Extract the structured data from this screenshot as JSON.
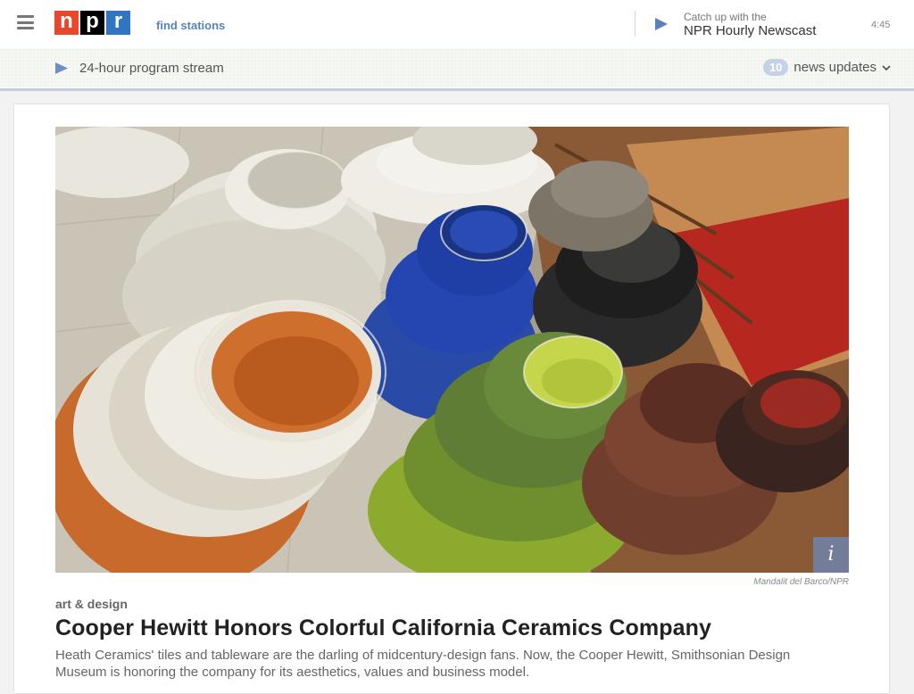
{
  "header": {
    "logo_letters": [
      "n",
      "p",
      "r"
    ],
    "find_stations": "find stations",
    "newscast": {
      "subtitle": "Catch up with the",
      "title": "NPR Hourly Newscast",
      "duration": "4:45"
    }
  },
  "stream_bar": {
    "stream_label": "24-hour program stream",
    "updates_count": "10",
    "updates_label": "news updates"
  },
  "story": {
    "image_alt": "Stacks of colorful ceramic bowls",
    "credit": "Mandalit del Barco/NPR",
    "info_label": "i",
    "slug": "art & design",
    "headline": "Cooper Hewitt Honors Colorful California Ceramics Company",
    "teaser": "Heath Ceramics' tiles and tableware are the darling of midcentury-design fans. Now, the Cooper Hewitt, Smithsonian Design Museum is honoring the company for its aesthetics, values and business model."
  },
  "colors": {
    "npr_red": "#e9472c",
    "npr_black": "#000000",
    "npr_blue": "#2f75c2",
    "link_blue": "#5784b6",
    "play_blue": "#5b7fbf"
  },
  "icons": {
    "menu": "hamburger-icon",
    "play": "play-icon",
    "chevron": "chevron-down-icon",
    "info": "info-icon"
  }
}
